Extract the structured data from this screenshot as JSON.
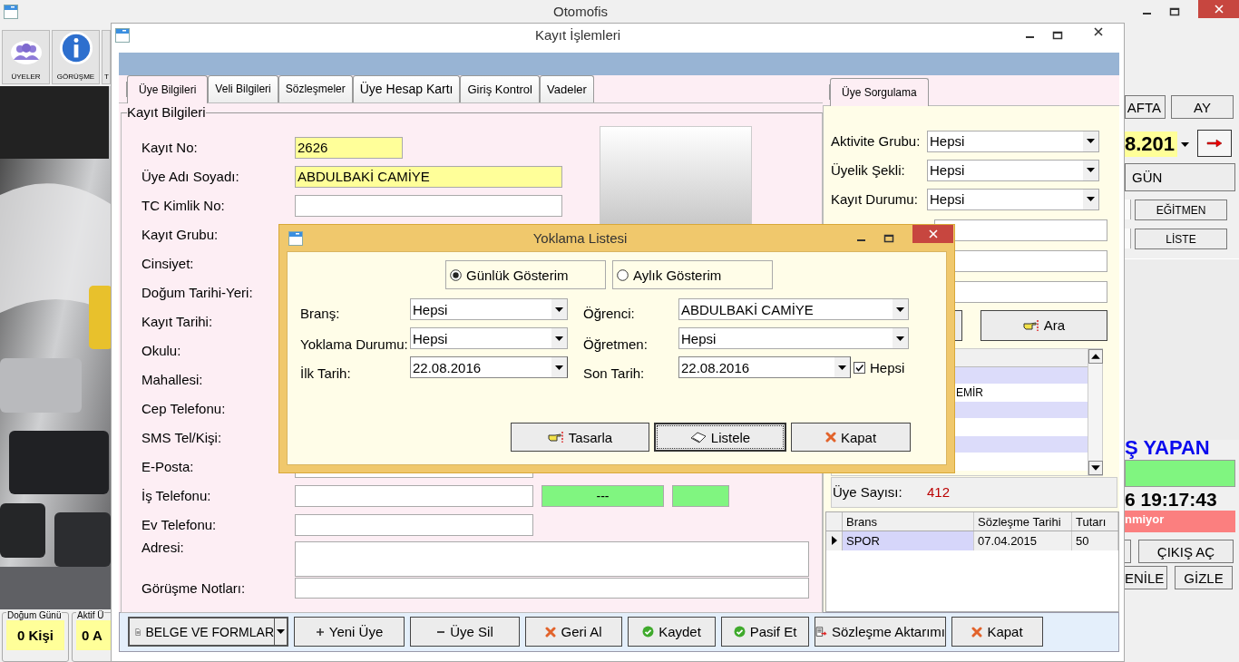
{
  "app": {
    "title": "Otomofis",
    "toolbar": [
      {
        "label": "ÜYELER",
        "kind": "people"
      },
      {
        "label": "GÖRÜŞME",
        "kind": "info"
      },
      {
        "label": "T",
        "kind": "partial"
      }
    ],
    "counters": [
      {
        "title": "Doğum Günü",
        "value": "0 Kişi"
      },
      {
        "title": "Aktif Ü",
        "value": "0 A"
      }
    ],
    "side": {
      "period_buttons": [
        "AFTA",
        "AY"
      ],
      "date": "8.201",
      "day_button": "GÜN",
      "list_buttons": [
        "EĞİTMEN",
        "LİSTE"
      ],
      "heading": "Ş YAPAN",
      "clock": "6 19:17:43",
      "alert": "nmiyor",
      "exit_button": "ÇIKIŞ AÇ",
      "last_buttons": [
        "ENİLE",
        "GİZLE"
      ]
    }
  },
  "record_window": {
    "title": "Kayıt İşlemleri",
    "tabs": [
      {
        "label": "Üye Bilgileri",
        "selected": true
      },
      {
        "label": "Veli Bilgileri",
        "selected": false
      },
      {
        "label": "Sözleşmeler",
        "selected": false
      },
      {
        "label": "Üye Hesap Kartı",
        "selected": false
      },
      {
        "label": "Giriş Kontrol",
        "selected": false
      },
      {
        "label": "Vadeler",
        "selected": false
      }
    ],
    "group_title": "Kayıt Bilgileri",
    "fields": [
      {
        "label": "Kayıt No:",
        "kind": "short",
        "highlighted": true,
        "value": "2626"
      },
      {
        "label": "Üye Adı Soyadı:",
        "kind": "medium",
        "highlighted": true,
        "value": "ABDULBAKİ CAMİYE"
      },
      {
        "label": "TC Kimlik No:",
        "kind": "medium",
        "highlighted": false
      },
      {
        "label": "Kayıt Grubu:"
      },
      {
        "label": "Cinsiyet:"
      },
      {
        "label": "Doğum Tarihi-Yeri:"
      },
      {
        "label": "Kayıt Tarihi:"
      },
      {
        "label": "Okulu:"
      },
      {
        "label": "Mahallesi:"
      },
      {
        "label": "Cep Telefonu:"
      },
      {
        "label": "SMS Tel/Kişi:"
      },
      {
        "label": "E-Posta:",
        "kind": "phone",
        "highlighted": false
      },
      {
        "label": "İş Telefonu:",
        "kind": "phone_status",
        "highlighted": false,
        "status": "---"
      },
      {
        "label": "Ev Telefonu:",
        "kind": "phone",
        "highlighted": false
      },
      {
        "label": "Adresi:",
        "kind": "area",
        "highlighted": false
      },
      {
        "label": "Görüşme Notları:",
        "kind": "wide",
        "highlighted": false
      }
    ],
    "query_tab": {
      "label": "Üye Sorgulama",
      "selected": true
    },
    "filters": [
      {
        "label": "Aktivite Grubu:",
        "value": "Hepsi"
      },
      {
        "label": "Üyelik Şekli:",
        "value": "Hepsi"
      },
      {
        "label": "Kayıt Durumu:",
        "value": "Hepsi"
      }
    ],
    "search_fields": [
      {
        "kind": "text"
      },
      {
        "kind": "text"
      },
      {
        "kind": "text"
      }
    ],
    "search_button": "Ara",
    "results": [
      {
        "kind": "row"
      },
      {
        "kind": "row",
        "text": "EMİR"
      },
      {
        "kind": "row"
      },
      {
        "kind": "row"
      },
      {
        "kind": "row"
      },
      {
        "kind": "row"
      }
    ],
    "member_count_label": "Üye Sayısı:",
    "member_count": "412",
    "contracts": {
      "columns": [
        "Brans",
        "Sözleşme Tarihi",
        "Tutarı"
      ],
      "rows": [
        {
          "selected": true,
          "cells": [
            "SPOR",
            "07.04.2015",
            "50"
          ]
        }
      ]
    },
    "buttons": [
      {
        "label": "BELGE VE FORMLAR",
        "kind": "menu"
      },
      {
        "label": "Yeni Üye",
        "kind": "add"
      },
      {
        "label": "Üye Sil",
        "kind": "remove"
      },
      {
        "label": "Geri Al",
        "kind": "cancel"
      },
      {
        "label": "Kaydet",
        "kind": "ok"
      },
      {
        "label": "Pasif Et",
        "kind": "ok"
      },
      {
        "label": "Sözleşme Aktarımı",
        "kind": "transfer"
      },
      {
        "label": "Kapat",
        "kind": "cancel"
      }
    ]
  },
  "dialog": {
    "title": "Yoklama Listesi",
    "modes": [
      {
        "label": "Günlük Gösterim",
        "selected": true
      },
      {
        "label": "Aylık Gösterim",
        "selected": false
      }
    ],
    "rows": [
      [
        {
          "label": "Branş:",
          "value": "Hepsi"
        },
        {
          "label": "Öğrenci:",
          "value": "ABDULBAKİ CAMİYE"
        }
      ],
      [
        {
          "label": "Yoklama Durumu:",
          "value": "Hepsi"
        },
        {
          "label": "Öğretmen:",
          "value": "Hepsi"
        }
      ]
    ],
    "dates": [
      {
        "label": "İlk Tarih:",
        "value": "22.08.2016"
      },
      {
        "label": "Son Tarih:",
        "value": "22.08.2016"
      }
    ],
    "all_dates": {
      "label": "Hepsi",
      "checked": true
    },
    "buttons": [
      {
        "label": "Tasarla",
        "kind": "design",
        "focused": false
      },
      {
        "label": "Listele",
        "kind": "list",
        "focused": true
      },
      {
        "label": "Kapat",
        "kind": "cancel",
        "focused": false
      }
    ]
  }
}
